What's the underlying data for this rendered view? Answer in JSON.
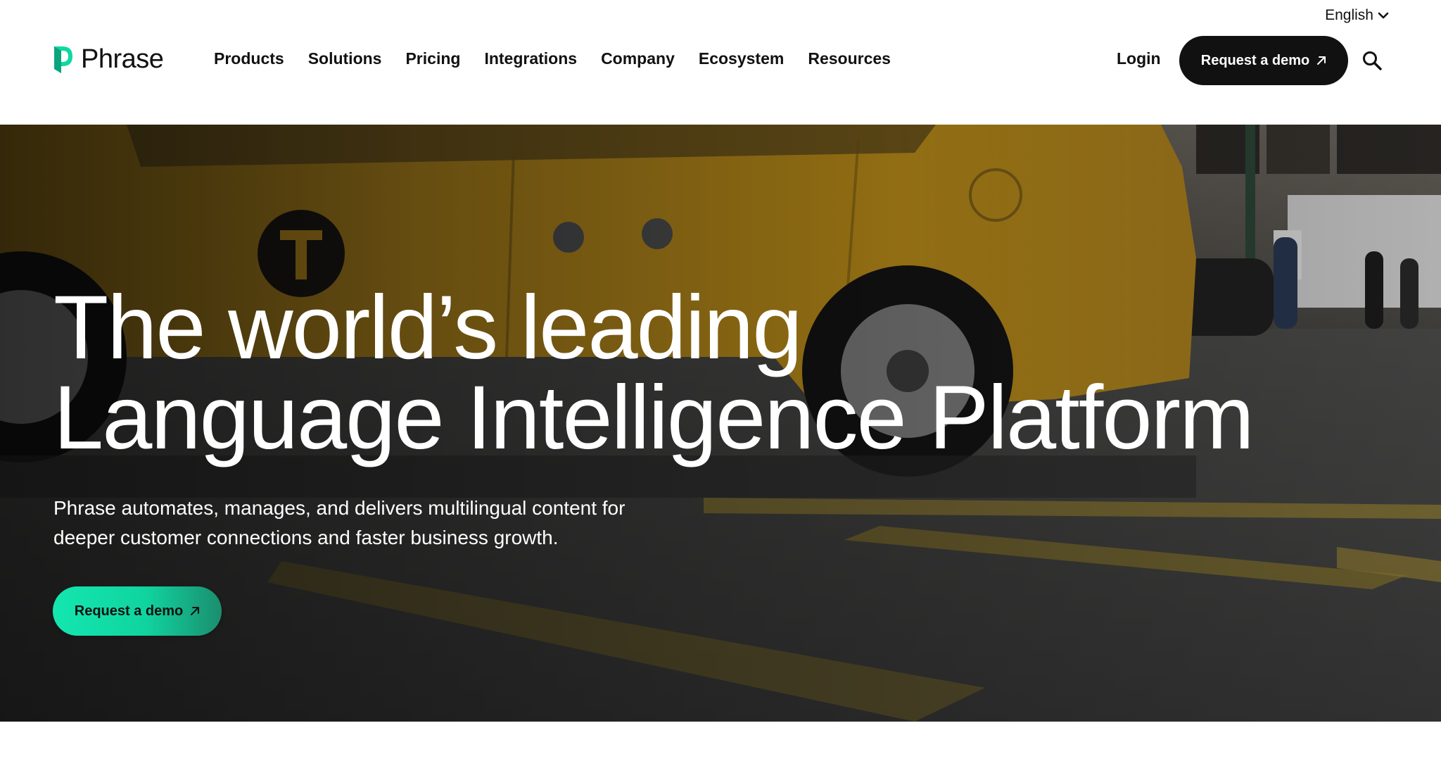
{
  "header": {
    "language": "English",
    "logo_text": "Phrase",
    "nav": [
      {
        "label": "Products"
      },
      {
        "label": "Solutions"
      },
      {
        "label": "Pricing"
      },
      {
        "label": "Integrations"
      },
      {
        "label": "Company"
      },
      {
        "label": "Ecosystem"
      },
      {
        "label": "Resources"
      }
    ],
    "login_label": "Login",
    "demo_label": "Request a demo",
    "icons": {
      "language_toggle": "chevron-down-icon",
      "demo": "arrow-up-right-icon",
      "search": "search-icon",
      "logo": "phrase-logo-icon"
    }
  },
  "hero": {
    "title_line1": "The world’s leading",
    "title_line2": "Language Intelligence Platform",
    "subtitle_line1": "Phrase automates, manages, and delivers multilingual content for",
    "subtitle_line2": "deeper customer connections and faster business growth.",
    "cta_label": "Request a demo",
    "background": "yellow-taxi-street-video"
  },
  "colors": {
    "accent": "#14e6b0",
    "dark_button": "#111111",
    "taxi_yellow": "#d9a31c",
    "background": "#ffffff"
  }
}
